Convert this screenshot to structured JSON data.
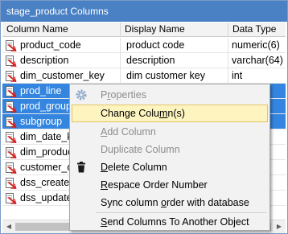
{
  "window": {
    "title": "stage_product Columns"
  },
  "columns_header": {
    "column_name": "Column Name",
    "display_name": "Display Name",
    "data_type": "Data Type"
  },
  "rows": [
    {
      "name": "product_code",
      "display": "product code",
      "type": "numeric(6)",
      "selected": false
    },
    {
      "name": "description",
      "display": "description",
      "type": "varchar(64)",
      "selected": false
    },
    {
      "name": "dim_customer_key",
      "display": "dim customer key",
      "type": "int",
      "selected": false
    },
    {
      "name": "prod_line",
      "display": "",
      "type": "4)",
      "selected": true
    },
    {
      "name": "prod_group",
      "display": "",
      "type": "4)",
      "selected": true
    },
    {
      "name": "subgroup",
      "display": "",
      "type": "4)",
      "selected": true
    },
    {
      "name": "dim_date_ke",
      "display": "",
      "type": "",
      "selected": false
    },
    {
      "name": "dim_produc",
      "display": "",
      "type": "",
      "selected": false
    },
    {
      "name": "customer_c",
      "display": "",
      "type": "4)",
      "selected": false
    },
    {
      "name": "dss_create_t",
      "display": "",
      "type": "",
      "selected": false
    },
    {
      "name": "dss_update_",
      "display": "",
      "type": "",
      "selected": false
    }
  ],
  "context_menu": {
    "properties": {
      "pre": "P",
      "ul": "r",
      "post": "operties"
    },
    "change_columns": {
      "pre": "Change Colu",
      "ul": "m",
      "post": "n(s)"
    },
    "add_column": {
      "pre": "",
      "ul": "A",
      "post": "dd Column"
    },
    "duplicate_column": {
      "pre": "Duplicate Column",
      "ul": "",
      "post": ""
    },
    "delete_column": {
      "pre": "",
      "ul": "D",
      "post": "elete Column"
    },
    "respace_order": {
      "pre": "",
      "ul": "R",
      "post": "espace Order Number"
    },
    "sync_column_order": {
      "pre": "Sync column ",
      "ul": "o",
      "post": "rder with database"
    },
    "send_columns": {
      "pre": "",
      "ul": "S",
      "post": "end Columns To Another Object"
    }
  },
  "colors": {
    "title_bar": "#4a80c4",
    "selection": "#3385e0",
    "menu_highlight": "#fdf4bf",
    "menu_highlight_border": "#e5c365",
    "disabled_text": "#8c8c8c"
  },
  "icons": {
    "column": "column-icon",
    "properties": "gear-icon",
    "delete": "trash-icon",
    "scroll_left": "scroll-left-icon",
    "scroll_right": "scroll-right-icon"
  }
}
